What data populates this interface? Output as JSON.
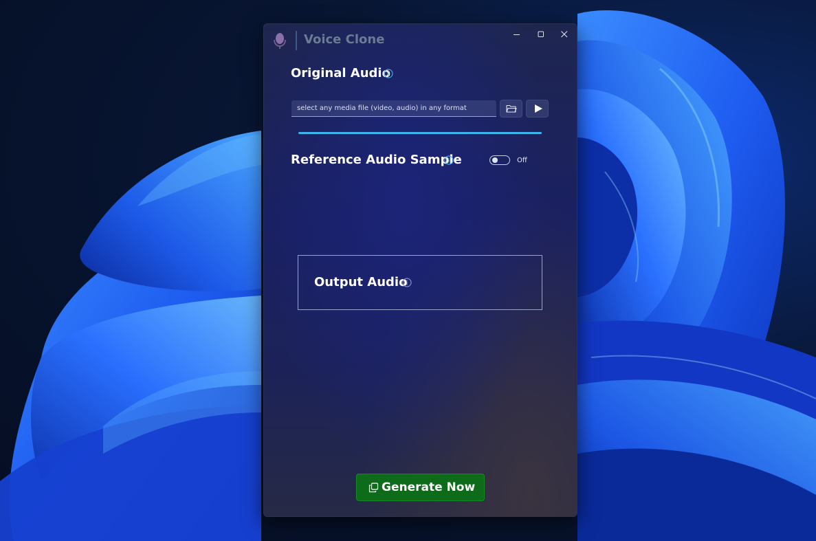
{
  "window": {
    "title": "Voice Clone",
    "controls": [
      "minimize",
      "maximize",
      "close"
    ]
  },
  "original_audio": {
    "title": "Original Audio",
    "file_input": {
      "value": "",
      "placeholder": "select any media file (video, audio) in any format"
    },
    "browse_icon": "folder-open-icon",
    "play_icon": "play-icon",
    "progress_fraction": 1.0
  },
  "reference_audio": {
    "title": "Reference Audio Sample",
    "toggle_state": "Off",
    "toggle_on": false
  },
  "output_audio": {
    "title": "Output Audio"
  },
  "actions": {
    "generate_label": "Generate Now",
    "generate_icon": "copy-icon"
  },
  "colors": {
    "accent": "#3db4ee",
    "generate_button": "#0d6b1a",
    "info_icon": "#4aa8e8"
  }
}
